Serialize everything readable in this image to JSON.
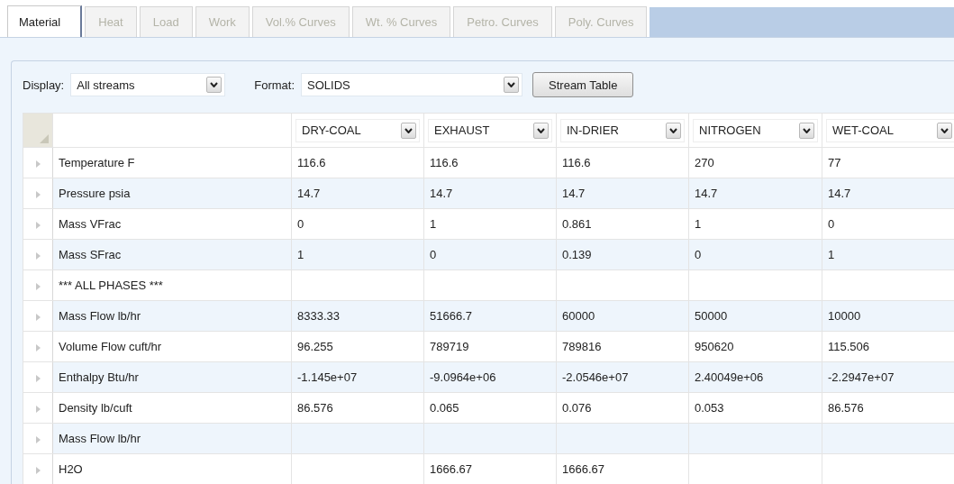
{
  "tabs": [
    {
      "label": "Material",
      "selected": true,
      "disabled": false
    },
    {
      "label": "Heat",
      "selected": false,
      "disabled": true
    },
    {
      "label": "Load",
      "selected": false,
      "disabled": true
    },
    {
      "label": "Work",
      "selected": false,
      "disabled": true
    },
    {
      "label": "Vol.% Curves",
      "selected": false,
      "disabled": true
    },
    {
      "label": "Wt. % Curves",
      "selected": false,
      "disabled": true
    },
    {
      "label": "Petro. Curves",
      "selected": false,
      "disabled": true
    },
    {
      "label": "Poly. Curves",
      "selected": false,
      "disabled": true
    }
  ],
  "toolbar": {
    "display_label": "Display:",
    "display_value": "All streams",
    "format_label": "Format:",
    "format_value": "SOLIDS",
    "button": "Stream Table"
  },
  "table": {
    "columns": [
      "DRY-COAL",
      "EXHAUST",
      "IN-DRIER",
      "NITROGEN",
      "WET-COAL"
    ],
    "rows": [
      {
        "label": "Temperature F",
        "cells": {
          "column_1": "116.6",
          "column_2": "116.6",
          "column_3": "116.6",
          "column_4": "270",
          "column_5": "77"
        }
      },
      {
        "label": "Pressure psia",
        "cells": {
          "column_1": "14.7",
          "column_2": "14.7",
          "column_3": "14.7",
          "column_4": "14.7",
          "column_5": "14.7"
        }
      },
      {
        "label": "Mass VFrac",
        "cells": {
          "column_1": "0",
          "column_2": "1",
          "column_3": "0.861",
          "column_4": "1",
          "column_5": "0"
        }
      },
      {
        "label": "Mass SFrac",
        "cells": {
          "column_1": "1",
          "column_2": "0",
          "column_3": "0.139",
          "column_4": "0",
          "column_5": "1"
        }
      },
      {
        "label": "*** ALL PHASES ***"
      },
      {
        "label": "Mass Flow lb/hr",
        "cells": {
          "column_1": "8333.33",
          "column_2": "51666.7",
          "column_3": "60000",
          "column_4": "50000",
          "column_5": "10000"
        }
      },
      {
        "label": "Volume Flow cuft/hr",
        "cells": {
          "column_1": "96.255",
          "column_2": "789719",
          "column_3": "789816",
          "column_4": "950620",
          "column_5": "115.506"
        }
      },
      {
        "label": "Enthalpy Btu/hr",
        "cells": {
          "column_1": "-1.145e+07",
          "column_2": "-9.0964e+06",
          "column_3": "-2.0546e+07",
          "column_4": "2.40049e+06",
          "column_5": "-2.2947e+07"
        }
      },
      {
        "label": "Density lb/cuft",
        "cells": {
          "column_1": "86.576",
          "column_2": "0.065",
          "column_3": "0.076",
          "column_4": "0.053",
          "column_5": "86.576"
        }
      },
      {
        "label": "Mass Flow lb/hr"
      },
      {
        "label": "H2O",
        "cells": {
          "column_2": "1666.67",
          "column_3": "1666.67"
        }
      }
    ]
  }
}
